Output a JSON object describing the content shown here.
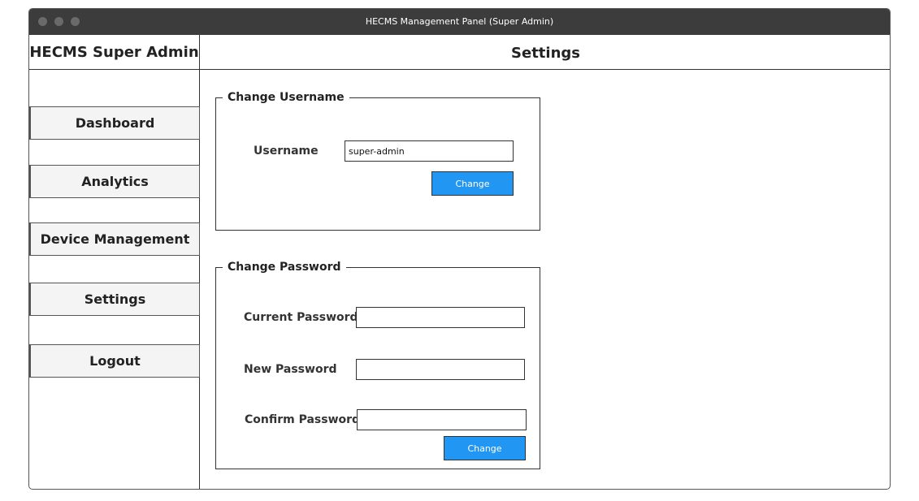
{
  "window": {
    "title": "HECMS Management Panel (Super Admin)"
  },
  "sidebar": {
    "brand": "HECMS Super Admin",
    "items": [
      {
        "label": "Dashboard"
      },
      {
        "label": "Analytics"
      },
      {
        "label": "Device Management"
      },
      {
        "label": "Settings"
      },
      {
        "label": "Logout"
      }
    ]
  },
  "main": {
    "title": "Settings"
  },
  "change_username": {
    "legend": "Change Username",
    "username_label": "Username",
    "username_value": "super-admin",
    "button": "Change"
  },
  "change_password": {
    "legend": "Change Password",
    "current_label": "Current Password",
    "new_label": "New Password",
    "confirm_label": "Confirm Password",
    "current_value": "",
    "new_value": "",
    "confirm_value": "",
    "button": "Change"
  },
  "colors": {
    "accent": "#2196f3",
    "titlebar": "#3c3c3c"
  }
}
